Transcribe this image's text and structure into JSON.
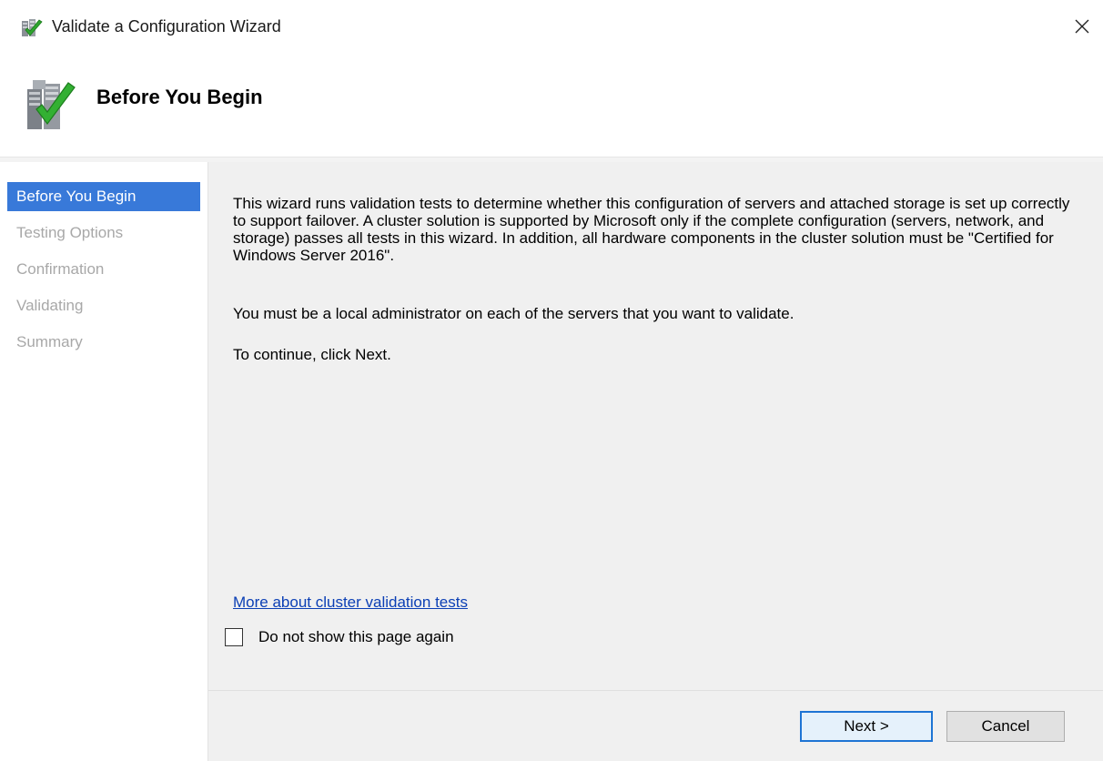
{
  "window": {
    "title": "Validate a Configuration Wizard",
    "title_icon": "cluster-validate-icon",
    "close_icon": "close-icon"
  },
  "header": {
    "title": "Before You Begin",
    "icon": "server-checkmark-icon"
  },
  "sidebar": {
    "items": [
      {
        "label": "Before You Begin",
        "active": true
      },
      {
        "label": "Testing Options",
        "active": false
      },
      {
        "label": "Confirmation",
        "active": false
      },
      {
        "label": "Validating",
        "active": false
      },
      {
        "label": "Summary",
        "active": false
      }
    ]
  },
  "main": {
    "paragraph1": "This wizard runs validation tests to determine whether this configuration of servers and attached storage is set up correctly to support failover. A cluster solution is supported by Microsoft only if the complete configuration (servers, network, and storage) passes all tests in this wizard. In addition, all hardware components in the cluster solution must be \"Certified for Windows Server 2016\".",
    "paragraph2": "You must be a local administrator on each of the servers that you want to validate.",
    "paragraph3": "To continue, click Next.",
    "link_text": "More about cluster validation tests",
    "checkbox_label": "Do not show this page again",
    "checkbox_checked": false
  },
  "footer": {
    "next_label": "Next >",
    "cancel_label": "Cancel"
  },
  "colors": {
    "accent": "#3879d9",
    "link": "#0b3fb5",
    "content_bg": "#f0f0f0",
    "disabled_text": "#a8a8a8"
  }
}
